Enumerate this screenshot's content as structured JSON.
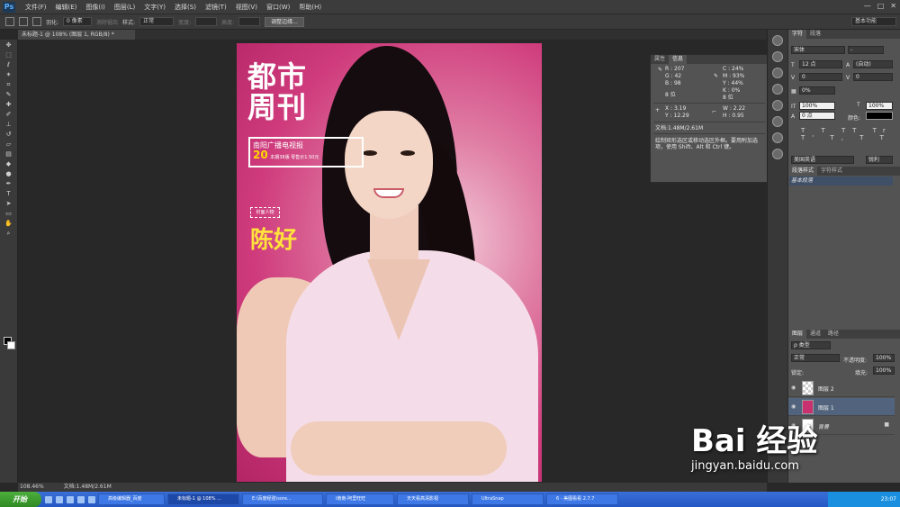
{
  "app": {
    "logo": "Ps"
  },
  "menu": [
    "文件(F)",
    "编辑(E)",
    "图像(I)",
    "图层(L)",
    "文字(Y)",
    "选择(S)",
    "滤镜(T)",
    "视图(V)",
    "窗口(W)",
    "帮助(H)"
  ],
  "window_controls": {
    "min": "—",
    "max": "□",
    "close": "✕"
  },
  "options": {
    "feather_label": "羽化:",
    "feather_value": "0 像素",
    "antialias": "消除锯齿",
    "style_label": "样式:",
    "style_value": "正常",
    "width_label": "宽度:",
    "height_label": "高度:",
    "refine_button": "调整边缘...",
    "workspace": "基本功能"
  },
  "document": {
    "tab_title": "未标题-1 @ 108% (图层 1, RGB/8) *",
    "status_zoom": "108.46%",
    "status_doc": "文档:1.48M/2.61M"
  },
  "poster": {
    "mast_line1": "都市",
    "mast_line2": "周刊",
    "sub_line1": "南阳广播电视报",
    "sub_issue": "20",
    "sub_line2": "本期38版 零售价1.50元",
    "marquee_text": "封面人物",
    "name": "陈好"
  },
  "info_panel": {
    "tabs": [
      "属性",
      "信息"
    ],
    "r": "R :   207",
    "g": "G :    42",
    "b": "B :    98",
    "c": "C :   24%",
    "m": "M :   93%",
    "y": "Y :   44%",
    "k": "K :    0%",
    "bit_left": "8 位",
    "bit_right": "8 位",
    "x": "X :   3.19",
    "yy": "Y :  12.29",
    "w": "W :   2.22",
    "h": "H :   0.95",
    "doc": "文档:1.48M/2.61M",
    "hint": "绘制矩形选区或移动选区外框。要用附加选项，使用 Shift、Alt 和 Ctrl 键。"
  },
  "character_panel": {
    "tabs": [
      "字符",
      "段落"
    ],
    "font": "宋体",
    "font_style": "-",
    "size": "12 点",
    "leading": "(自动)",
    "tracking": "0",
    "kerning": "0",
    "vscale": "0%",
    "hscale_v": "100%",
    "hscale_h": "100%",
    "baseline": "0 点",
    "color_label": "颜色:",
    "glyphs": "T T TT Tr T' T, T T",
    "language": "美国英语",
    "aa": "锐利"
  },
  "para_styles": {
    "tabs": [
      "段落样式",
      "字符样式"
    ],
    "selected": "基本段落"
  },
  "layers_panel": {
    "tabs": [
      "图层",
      "通道",
      "路径"
    ],
    "kind": "ρ 类型",
    "blend": "正常",
    "opacity_label": "不透明度:",
    "opacity": "100%",
    "lock_label": "锁定:",
    "fill_label": "填充:",
    "fill": "100%",
    "layers": [
      {
        "name": "图层 2",
        "selected": false
      },
      {
        "name": "图层 1",
        "selected": true
      },
      {
        "name": "背景",
        "selected": false
      }
    ]
  },
  "taskbar": {
    "start": "开始",
    "items": [
      "高级编辑器_百度",
      "未标题-1 @ 108% ...",
      "E:\\百度经验\\sore...",
      "i南南-阿里旺旺",
      "天天看高清影视",
      "UltraSnap",
      "6 - 美图看看 2.7.7"
    ],
    "time": "23:07"
  },
  "watermark": {
    "logo": "Bai 经验",
    "url": "jingyan.baidu.com"
  }
}
